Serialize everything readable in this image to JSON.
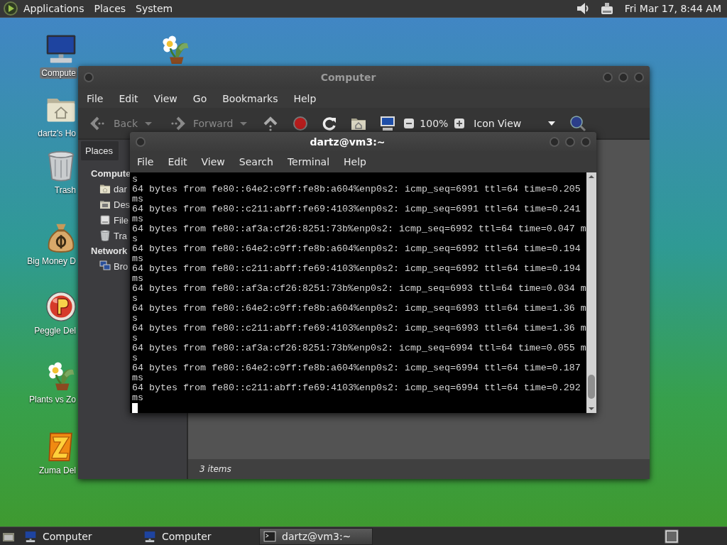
{
  "top_panel": {
    "menus": [
      "Applications",
      "Places",
      "System"
    ],
    "clock": "Fri Mar 17,  8:44 AM"
  },
  "desktop_icons": [
    {
      "kind": "computer",
      "label": "Compute",
      "selected": true
    },
    {
      "kind": "plant",
      "selected": false
    },
    {
      "kind": "home",
      "label": "dartz's Ho",
      "selected": false
    },
    {
      "kind": "trash",
      "label": "Trash",
      "selected": false
    },
    {
      "kind": "moneybag",
      "label": "Big Money D",
      "selected": false
    },
    {
      "kind": "peggle",
      "label": "Peggle Del",
      "selected": false
    },
    {
      "kind": "plant",
      "label": "Plants vs Zo",
      "selected": false
    },
    {
      "kind": "zuma",
      "label": "Zuma Del",
      "selected": false
    }
  ],
  "file_manager": {
    "title": "Computer",
    "active": false,
    "menus": [
      "File",
      "Edit",
      "View",
      "Go",
      "Bookmarks",
      "Help"
    ],
    "toolbar": {
      "back": {
        "label": "Back",
        "disabled": true
      },
      "forward": {
        "label": "Forward",
        "disabled": true
      },
      "zoom": "100%",
      "view": "Icon View"
    },
    "sidebar": {
      "header": "Places",
      "sections": [
        {
          "heading": "Compute",
          "items": [
            {
              "kind": "home",
              "label": "dar"
            },
            {
              "kind": "desktop",
              "label": "Des"
            },
            {
              "kind": "filesystem",
              "label": "File"
            },
            {
              "kind": "trash",
              "label": "Tra"
            }
          ]
        },
        {
          "heading": "Network",
          "items": [
            {
              "kind": "network",
              "label": "Bro"
            }
          ]
        }
      ]
    },
    "status_bar": "3 items"
  },
  "terminal": {
    "title": "dartz@vm3:~",
    "active": true,
    "menus": [
      "File",
      "Edit",
      "View",
      "Search",
      "Terminal",
      "Help"
    ],
    "lines": [
      "s",
      "64 bytes from fe80::64e2:c9ff:fe8b:a604%enp0s2: icmp_seq=6991 ttl=64 time=0.205",
      "ms",
      "64 bytes from fe80::c211:abff:fe69:4103%enp0s2: icmp_seq=6991 ttl=64 time=0.241",
      "ms",
      "64 bytes from fe80::af3a:cf26:8251:73b%enp0s2: icmp_seq=6992 ttl=64 time=0.047 m",
      "s",
      "64 bytes from fe80::64e2:c9ff:fe8b:a604%enp0s2: icmp_seq=6992 ttl=64 time=0.194",
      "ms",
      "64 bytes from fe80::c211:abff:fe69:4103%enp0s2: icmp_seq=6992 ttl=64 time=0.194",
      "ms",
      "64 bytes from fe80::af3a:cf26:8251:73b%enp0s2: icmp_seq=6993 ttl=64 time=0.034 m",
      "s",
      "64 bytes from fe80::64e2:c9ff:fe8b:a604%enp0s2: icmp_seq=6993 ttl=64 time=1.36 m",
      "s",
      "64 bytes from fe80::c211:abff:fe69:4103%enp0s2: icmp_seq=6993 ttl=64 time=1.36 m",
      "s",
      "64 bytes from fe80::af3a:cf26:8251:73b%enp0s2: icmp_seq=6994 ttl=64 time=0.055 m",
      "s",
      "64 bytes from fe80::64e2:c9ff:fe8b:a604%enp0s2: icmp_seq=6994 ttl=64 time=0.187",
      "ms",
      "64 bytes from fe80::c211:abff:fe69:4103%enp0s2: icmp_seq=6994 ttl=64 time=0.292",
      "ms"
    ]
  },
  "taskbar": {
    "items": [
      {
        "kind": "computer",
        "label": "Computer",
        "selected": false
      },
      {
        "kind": "computer",
        "label": "Computer",
        "selected": false
      },
      {
        "kind": "terminal",
        "label": "dartz@vm3:~",
        "selected": true
      }
    ]
  }
}
